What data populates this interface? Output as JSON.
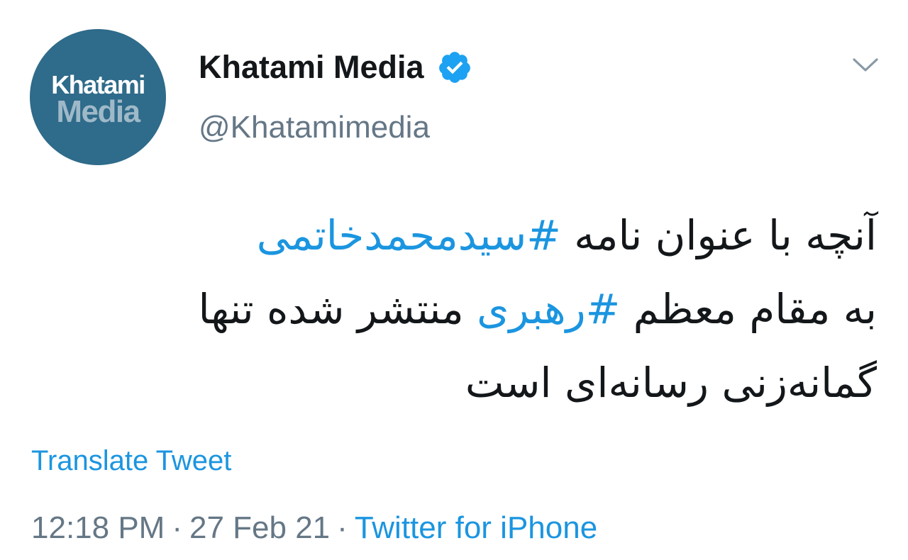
{
  "author": {
    "avatar_line1": "Khatami",
    "avatar_line2": "Media",
    "display_name": "Khatami Media",
    "handle": "@Khatamimedia",
    "verified": true
  },
  "tweet": {
    "line1_text": "آنچه با عنوان نامه ",
    "line1_hashtag": "#سیدمحمدخاتمی",
    "line2_text_before": "به مقام معظم ",
    "line2_hashtag": "#رهبری",
    "line2_text_after": " منتشر شده تنها",
    "line3_text": "گمانه‌زنی رسانه‌ای است"
  },
  "translate_label": "Translate Tweet",
  "meta": {
    "time": "12:18 PM",
    "separator": "·",
    "date": "27 Feb 21",
    "source": "Twitter for iPhone"
  },
  "colors": {
    "link": "#1b95e0",
    "secondary_text": "#657786",
    "primary_text": "#14171a",
    "avatar_bg": "#2f6b8a",
    "verified_badge": "#1da1f2"
  },
  "icons": {
    "verified": "verified-badge-icon",
    "caret": "chevron-down-icon"
  }
}
